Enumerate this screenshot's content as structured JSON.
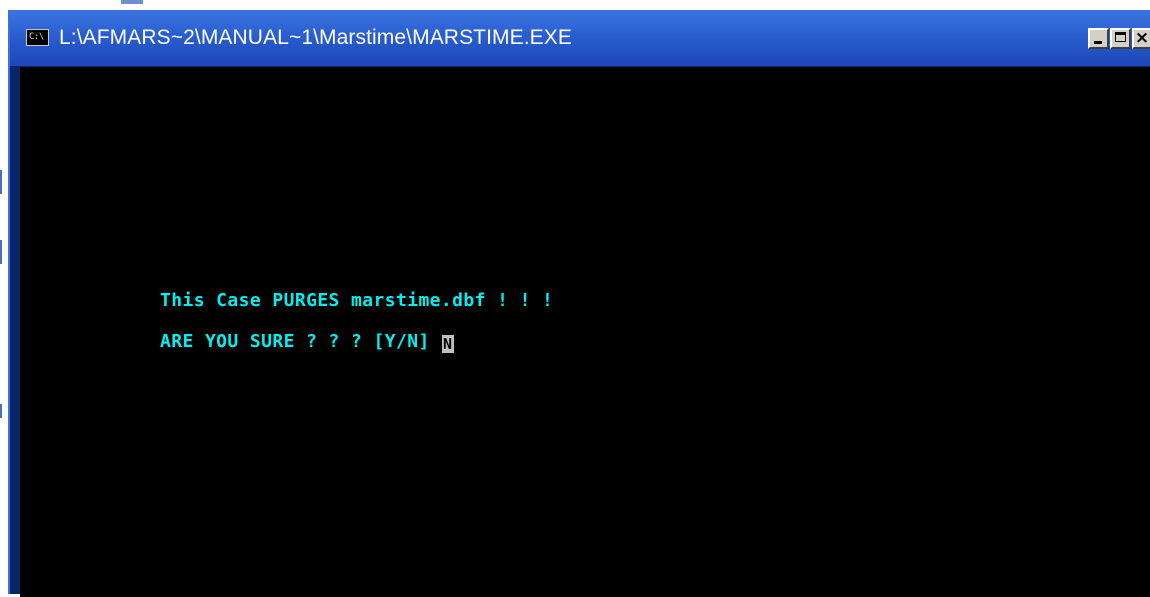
{
  "window": {
    "title": "L:\\AFMARS~2\\MANUAL~1\\Marstime\\MARSTIME.EXE",
    "system_icon_label": "C:\\",
    "system_icon": "console-icon",
    "controls": {
      "minimize": "minimize-icon",
      "maximize": "maximize-icon",
      "close": "close-icon",
      "close_glyph": "×"
    }
  },
  "console": {
    "lines": [
      "This Case PURGES marstime.dbf ! ! !",
      "ARE YOU SURE ? ? ? [Y/N]"
    ],
    "input_value": "N"
  },
  "colors": {
    "console_background": "#000000",
    "console_text": "#00f0f0",
    "titlebar": "#2b5fd0"
  }
}
